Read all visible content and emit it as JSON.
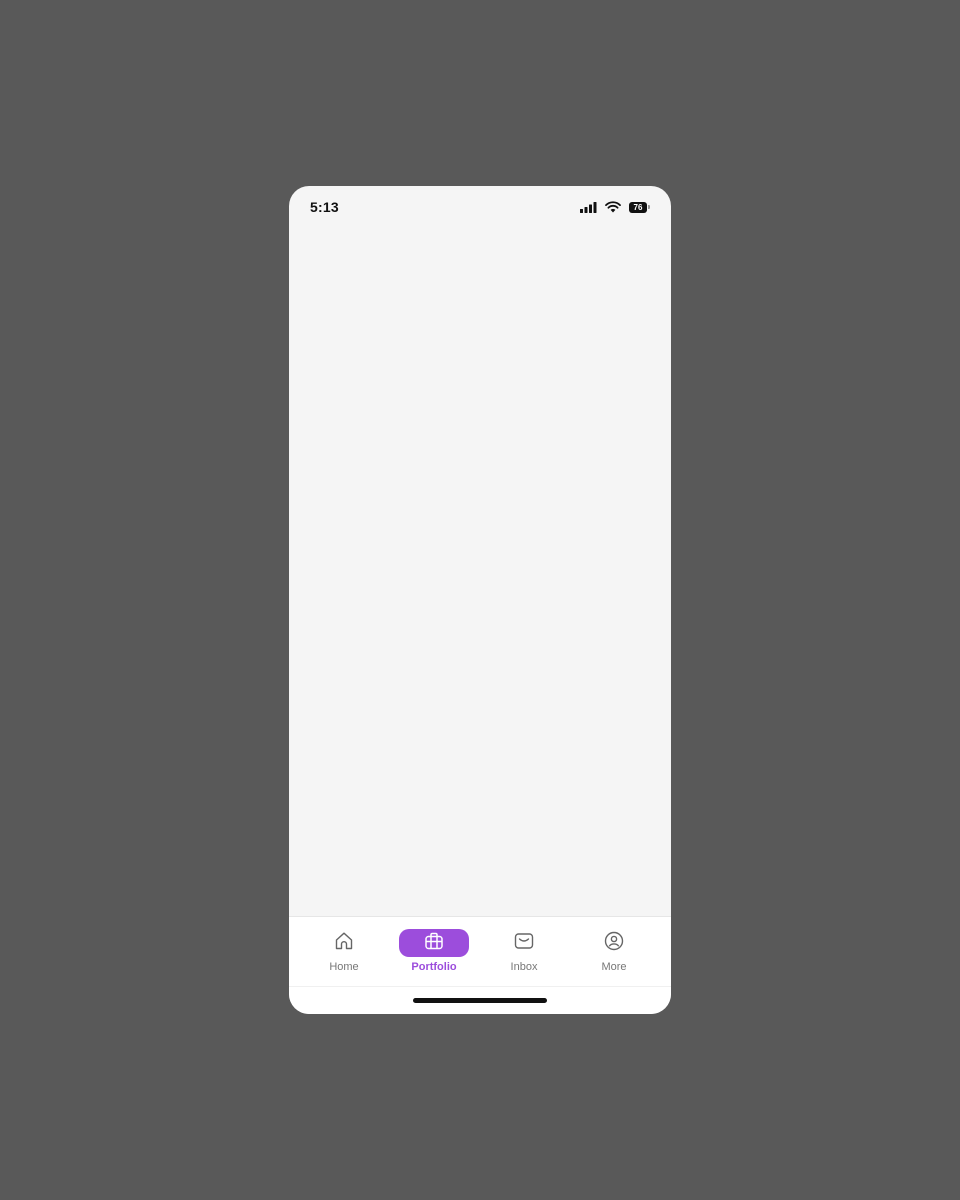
{
  "status_bar": {
    "time": "5:13",
    "battery_level": "76",
    "signal_icon": "cellular-signal-icon",
    "wifi_icon": "wifi-icon"
  },
  "tab_bar": {
    "active_tab": "Portfolio",
    "accent_color": "#9c4ddc",
    "tabs": [
      {
        "label": "Home",
        "icon": "home-icon"
      },
      {
        "label": "Portfolio",
        "icon": "briefcase-icon"
      },
      {
        "label": "Inbox",
        "icon": "inbox-icon"
      },
      {
        "label": "More",
        "icon": "profile-icon"
      }
    ]
  }
}
